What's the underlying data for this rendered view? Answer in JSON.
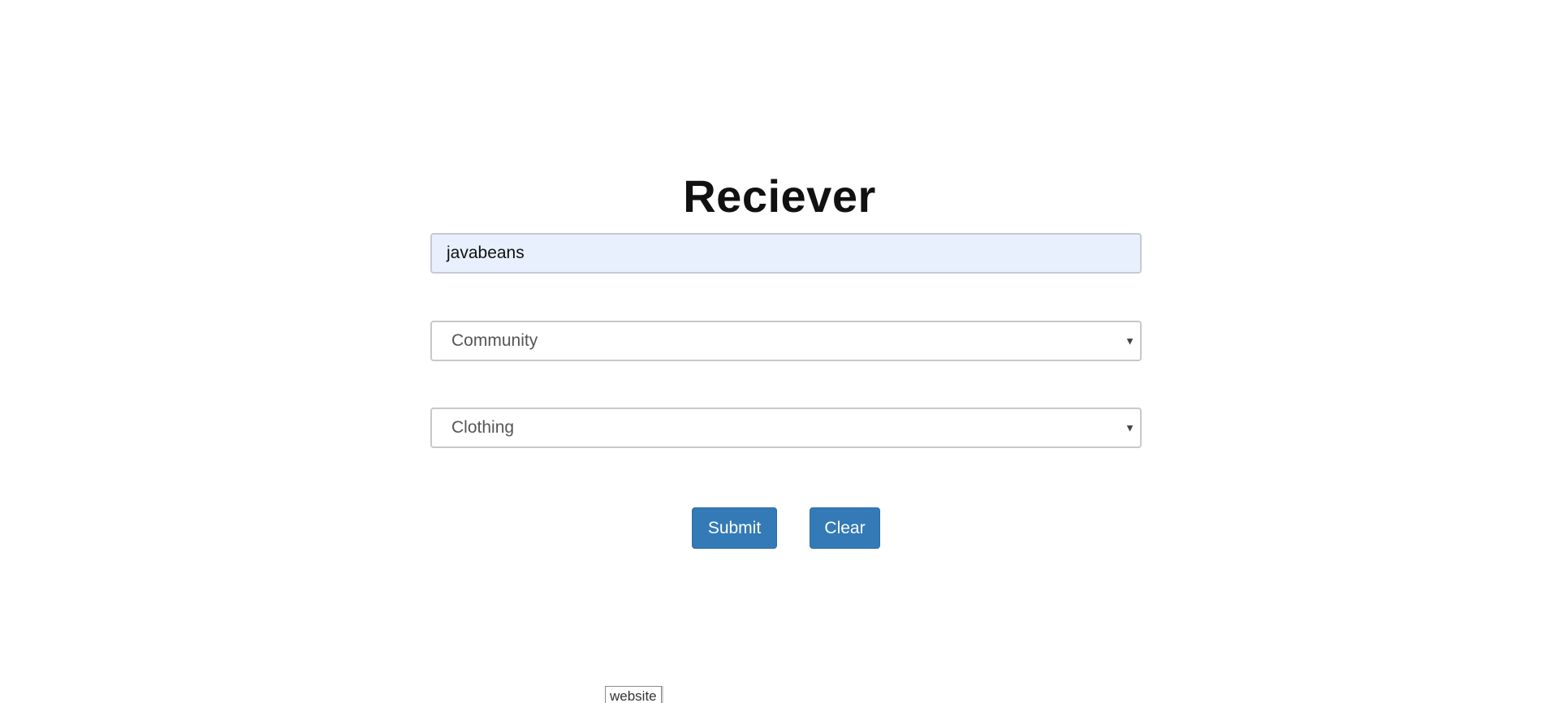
{
  "form": {
    "title": "Reciever",
    "name_input": {
      "value": "javabeans"
    },
    "community_select": {
      "selected": "Community"
    },
    "category_select": {
      "selected": "Clothing"
    },
    "submit_label": "Submit",
    "clear_label": "Clear"
  },
  "footer": {
    "website_label": "website"
  },
  "colors": {
    "button_primary": "#337ab7",
    "autofill_background": "#e8f0fe"
  }
}
